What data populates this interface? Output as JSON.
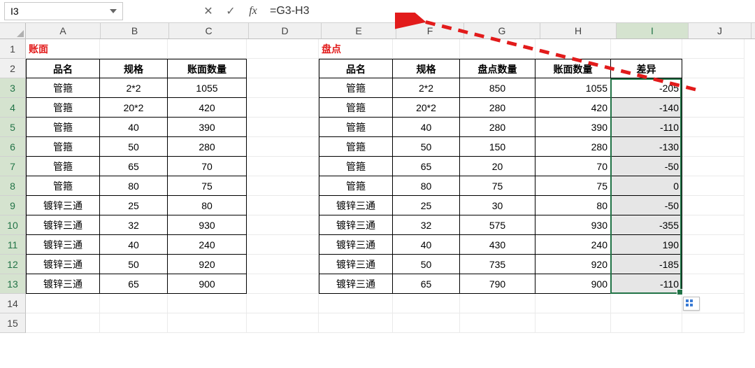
{
  "namebox": "I3",
  "formula": "=G3-H3",
  "cols": {
    "A": "A",
    "B": "B",
    "C": "C",
    "D": "D",
    "E": "E",
    "F": "F",
    "G": "G",
    "H": "H",
    "I": "I",
    "J": "J"
  },
  "rowlabels": [
    "1",
    "2",
    "3",
    "4",
    "5",
    "6",
    "7",
    "8",
    "9",
    "10",
    "11",
    "12",
    "13",
    "14",
    "15"
  ],
  "titles": {
    "book": "账面",
    "count": "盘点"
  },
  "headers1": {
    "name": "品名",
    "spec": "规格",
    "qty": "账面数量"
  },
  "headers2": {
    "name": "品名",
    "spec": "规格",
    "count_qty": "盘点数量",
    "book_qty": "账面数量",
    "diff": "差异"
  },
  "table1": [
    {
      "name": "管箍",
      "spec": "2*2",
      "qty": "1055"
    },
    {
      "name": "管箍",
      "spec": "20*2",
      "qty": "420"
    },
    {
      "name": "管箍",
      "spec": "40",
      "qty": "390"
    },
    {
      "name": "管箍",
      "spec": "50",
      "qty": "280"
    },
    {
      "name": "管箍",
      "spec": "65",
      "qty": "70"
    },
    {
      "name": "管箍",
      "spec": "80",
      "qty": "75"
    },
    {
      "name": "镀锌三通",
      "spec": "25",
      "qty": "80"
    },
    {
      "name": "镀锌三通",
      "spec": "32",
      "qty": "930"
    },
    {
      "name": "镀锌三通",
      "spec": "40",
      "qty": "240"
    },
    {
      "name": "镀锌三通",
      "spec": "50",
      "qty": "920"
    },
    {
      "name": "镀锌三通",
      "spec": "65",
      "qty": "900"
    }
  ],
  "table2": [
    {
      "name": "管箍",
      "spec": "2*2",
      "count": "850",
      "book": "1055",
      "diff": "-205"
    },
    {
      "name": "管箍",
      "spec": "20*2",
      "count": "280",
      "book": "420",
      "diff": "-140"
    },
    {
      "name": "管箍",
      "spec": "40",
      "count": "280",
      "book": "390",
      "diff": "-110"
    },
    {
      "name": "管箍",
      "spec": "50",
      "count": "150",
      "book": "280",
      "diff": "-130"
    },
    {
      "name": "管箍",
      "spec": "65",
      "count": "20",
      "book": "70",
      "diff": "-50"
    },
    {
      "name": "管箍",
      "spec": "80",
      "count": "75",
      "book": "75",
      "diff": "0"
    },
    {
      "name": "镀锌三通",
      "spec": "25",
      "count": "30",
      "book": "80",
      "diff": "-50"
    },
    {
      "name": "镀锌三通",
      "spec": "32",
      "count": "575",
      "book": "930",
      "diff": "-355"
    },
    {
      "name": "镀锌三通",
      "spec": "40",
      "count": "430",
      "book": "240",
      "diff": "190"
    },
    {
      "name": "镀锌三通",
      "spec": "50",
      "count": "735",
      "book": "920",
      "diff": "-185"
    },
    {
      "name": "镀锌三通",
      "spec": "65",
      "count": "790",
      "book": "900",
      "diff": "-110"
    }
  ],
  "colors": {
    "accent": "#217346",
    "arrow": "#e21b1b"
  }
}
